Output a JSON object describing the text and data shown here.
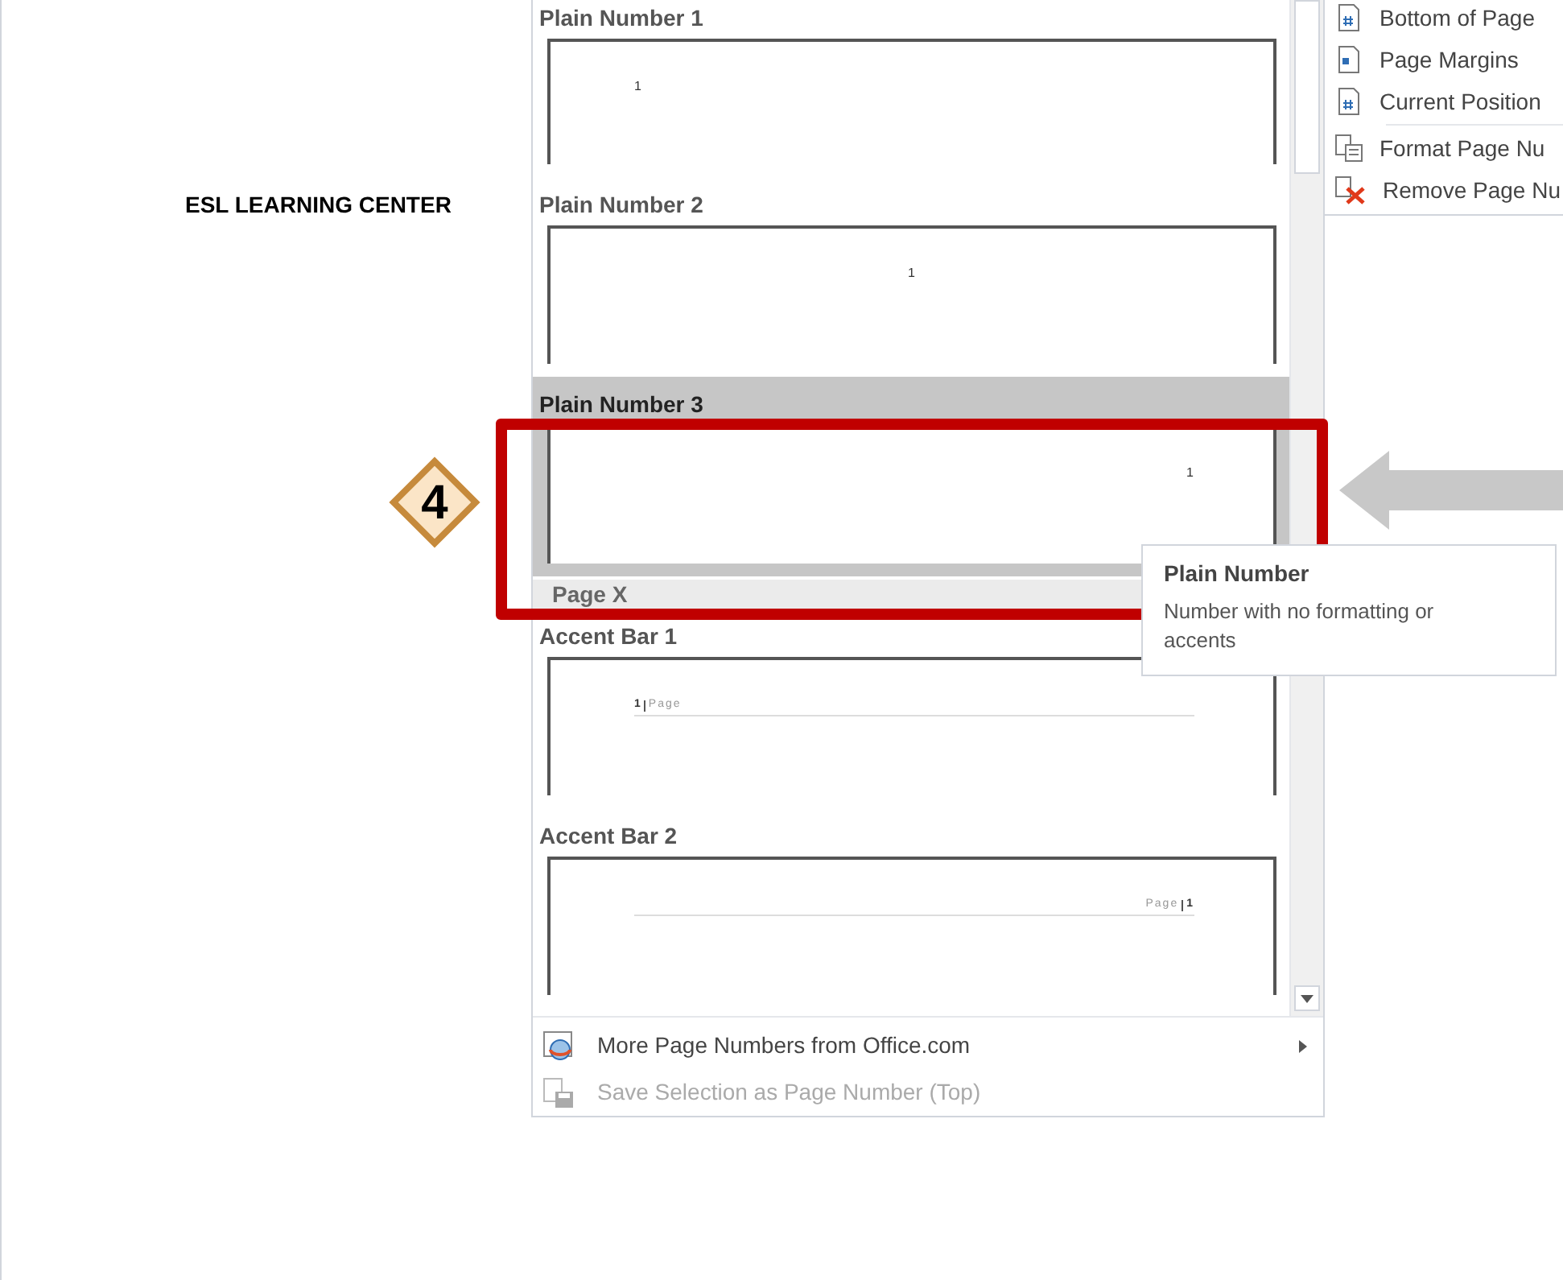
{
  "document": {
    "heading": "ESL LEARNING CENTER"
  },
  "step_badge": {
    "label": "4"
  },
  "gallery": {
    "groups": [
      {
        "items": [
          {
            "title": "Plain Number 1",
            "kind": "plain",
            "number": "1",
            "selected": false
          },
          {
            "title": "Plain Number 2",
            "kind": "plain",
            "number": "1",
            "selected": false
          },
          {
            "title": "Plain Number 3",
            "kind": "plain",
            "number": "1",
            "selected": true
          }
        ]
      },
      {
        "title": "Page X",
        "items": [
          {
            "title": "Accent Bar 1",
            "kind": "accent",
            "number": "1",
            "word": "Page",
            "selected": false
          },
          {
            "title": "Accent Bar 2",
            "kind": "accent",
            "number": "1",
            "word": "Page",
            "selected": false
          }
        ]
      }
    ]
  },
  "footer_items": [
    {
      "label": "More Page Numbers from Office.com",
      "kind": "globe",
      "submenu": true,
      "disabled": false
    },
    {
      "label": "Save Selection as Page Number (Top)",
      "kind": "save",
      "submenu": false,
      "disabled": true
    }
  ],
  "side_menu": [
    {
      "label": "Bottom of Page",
      "kind": "page"
    },
    {
      "label": "Page Margins",
      "kind": "margin"
    },
    {
      "label": "Current Position",
      "kind": "page"
    },
    {
      "label": "Format Page Nu",
      "kind": "format"
    },
    {
      "label": "Remove Page Nu",
      "kind": "remove"
    }
  ],
  "tooltip": {
    "title": "Plain Number",
    "text": "Number with no formatting or accents"
  }
}
